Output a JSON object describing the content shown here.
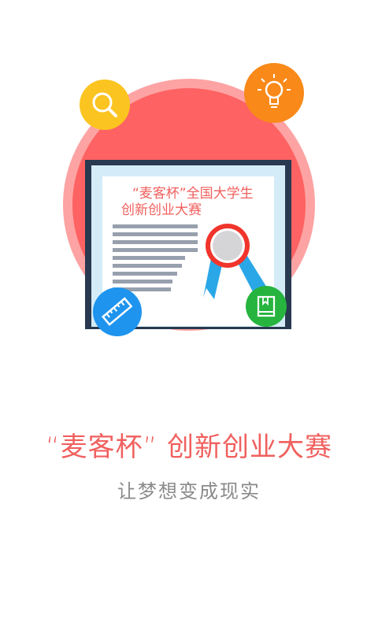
{
  "certificate": {
    "line1": "“麦客杯”全国大学生",
    "line2": "创新创业大赛"
  },
  "headline": {
    "title": "“麦客杯” 创新创业大赛",
    "subtitle": "让梦想变成现实"
  },
  "icons": {
    "search": "search-icon",
    "lightbulb": "lightbulb-icon",
    "ruler": "ruler-icon",
    "book": "book-icon",
    "ribbon": "award-ribbon-icon"
  },
  "colors": {
    "circle_outer": "#fda3a3",
    "circle_inner": "#fe6262",
    "accent_red": "#f0605e",
    "yellow": "#fcc421",
    "orange": "#f98919",
    "blue": "#1f94ee",
    "green": "#26b43f",
    "frame_dark": "#29394f",
    "paper_light": "#d4ecf8"
  }
}
